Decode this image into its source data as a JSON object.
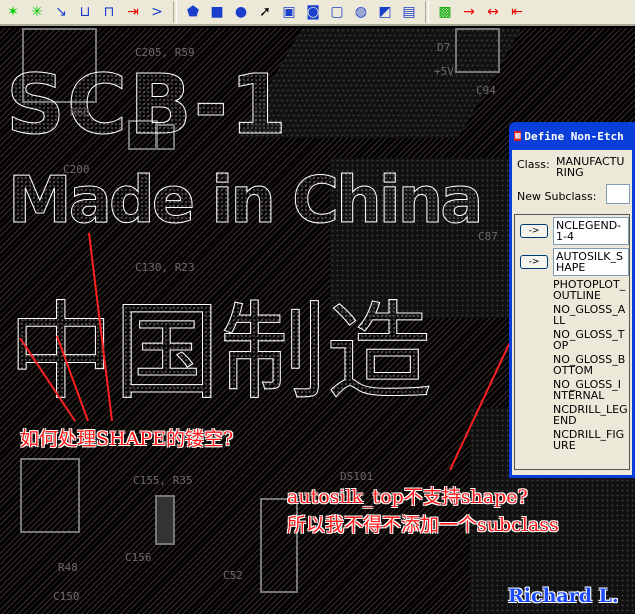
{
  "toolbar": {
    "icons": [
      "route-icon",
      "fanout-icon",
      "slide-icon",
      "delay-tune-icon",
      "spread-icon",
      "custom-smooth-icon",
      "add-connect-icon",
      "shape-polygon-icon",
      "shape-rectangle-icon",
      "shape-circle-icon",
      "select-pointer-icon",
      "shape-void-icon",
      "void-circle-icon",
      "void-rectangle-icon",
      "void-circle2-icon",
      "shape-edit-icon",
      "merge-shapes-icon",
      "drc-icon",
      "dimension-icon",
      "dimension-linear-icon",
      "datum-icon"
    ]
  },
  "board": {
    "silk_text": {
      "line1": "SCB-1",
      "line2": "Made in China",
      "line3": "中国制造"
    },
    "refdes": [
      "C205, R59",
      "C200",
      "C130, R23",
      "R60",
      "D7",
      "+5V",
      "C94",
      "C87",
      "C155, R35",
      "C156",
      "R48",
      "C150",
      "C52",
      "DS101"
    ]
  },
  "annotations": {
    "left": "如何处理SHAPE的镂空?",
    "right_line1": "autosilk_top不支持shape?",
    "right_line2": "所以我不得不添加一个subclass",
    "signature": "Richard L.",
    "color": "#ff1a1a",
    "signature_color": "#1a4bff"
  },
  "dialog": {
    "title": "Define Non-Etch",
    "class_label": "Class:",
    "class_value": "MANUFACTURING",
    "new_subclass_label": "New Subclass:",
    "arrow_label": "->",
    "subclasses": [
      "NCLEGEND-1-4",
      "AUTOSILK_SHAPE",
      "PHOTOPLOT_OUTLINE",
      "NO_GLOSS_ALL",
      "NO_GLOSS_TOP",
      "NO_GLOSS_BOTTOM",
      "NO_GLOSS_INTERNAL",
      "NCDRILL_LEGEND",
      "NCDRILL_FIGURE"
    ]
  }
}
